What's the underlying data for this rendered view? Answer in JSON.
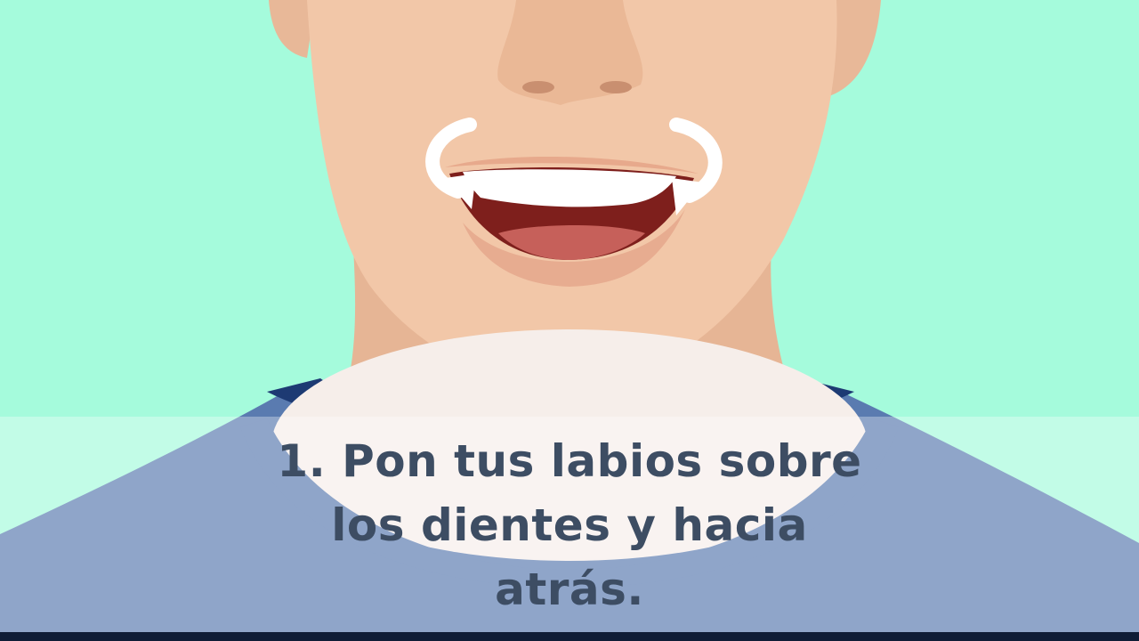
{
  "caption": {
    "lines": [
      "1. Pon tus labios sobre",
      "los dientes y hacia",
      "atrás."
    ]
  },
  "illustration": {
    "subject": "face-lower-half",
    "arrow_icons": [
      "curved-arrow-left-icon",
      "curved-arrow-right-icon"
    ]
  },
  "colors": {
    "background": "#a5fbdc",
    "skin": "#f2c7a8",
    "shirt": "#5a7bb0",
    "caption_text": "#3d4d63"
  }
}
